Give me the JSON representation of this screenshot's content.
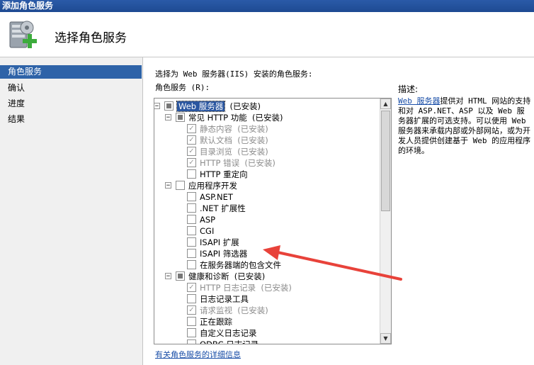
{
  "window": {
    "title": "添加角色服务"
  },
  "header": {
    "title": "选择角色服务"
  },
  "steps": [
    {
      "label": "角色服务",
      "active": true
    },
    {
      "label": "确认",
      "active": false
    },
    {
      "label": "进度",
      "active": false
    },
    {
      "label": "结果",
      "active": false
    }
  ],
  "main": {
    "instruction": "选择为 Web 服务器(IIS) 安装的角色服务:",
    "role_services_label": "角色服务 (R):",
    "description_label": "描述:",
    "description_link": "Web 服务器",
    "description_text": "提供对 HTML 网站的支持和对 ASP.NET、ASP 以及 Web 服务器扩展的可选支持。可以使用 Web 服务器来承载内部或外部网站，或为开发人员提供创建基于 Web 的应用程序的环境。",
    "more_info_link": "有关角色服务的详细信息"
  },
  "tree": [
    {
      "name": "Web 服务器",
      "status": "(已安装)",
      "level": 0,
      "expander": "−",
      "state": "partial",
      "selected": true
    },
    {
      "name": "常见 HTTP 功能",
      "status": "(已安装)",
      "level": 1,
      "expander": "−",
      "state": "partial"
    },
    {
      "name": "静态内容",
      "status": "(已安装)",
      "level": 2,
      "state": "checked-disabled"
    },
    {
      "name": "默认文档",
      "status": "(已安装)",
      "level": 2,
      "state": "checked-disabled"
    },
    {
      "name": "目录浏览",
      "status": "(已安装)",
      "level": 2,
      "state": "checked-disabled"
    },
    {
      "name": "HTTP 错误",
      "status": "(已安装)",
      "level": 2,
      "state": "checked-disabled"
    },
    {
      "name": "HTTP 重定向",
      "status": "",
      "level": 2,
      "state": "unchecked"
    },
    {
      "name": "应用程序开发",
      "status": "",
      "level": 1,
      "expander": "−",
      "state": "unchecked"
    },
    {
      "name": "ASP.NET",
      "status": "",
      "level": 2,
      "state": "unchecked"
    },
    {
      "name": ".NET 扩展性",
      "status": "",
      "level": 2,
      "state": "unchecked"
    },
    {
      "name": "ASP",
      "status": "",
      "level": 2,
      "state": "unchecked"
    },
    {
      "name": "CGI",
      "status": "",
      "level": 2,
      "state": "unchecked"
    },
    {
      "name": "ISAPI 扩展",
      "status": "",
      "level": 2,
      "state": "unchecked"
    },
    {
      "name": "ISAPI 筛选器",
      "status": "",
      "level": 2,
      "state": "unchecked"
    },
    {
      "name": "在服务器端的包含文件",
      "status": "",
      "level": 2,
      "state": "unchecked"
    },
    {
      "name": "健康和诊断",
      "status": "(已安装)",
      "level": 1,
      "expander": "−",
      "state": "partial"
    },
    {
      "name": "HTTP 日志记录",
      "status": "(已安装)",
      "level": 2,
      "state": "checked-disabled"
    },
    {
      "name": "日志记录工具",
      "status": "",
      "level": 2,
      "state": "unchecked"
    },
    {
      "name": "请求监视",
      "status": "(已安装)",
      "level": 2,
      "state": "checked-disabled"
    },
    {
      "name": "正在跟踪",
      "status": "",
      "level": 2,
      "state": "unchecked"
    },
    {
      "name": "自定义日志记录",
      "status": "",
      "level": 2,
      "state": "unchecked"
    },
    {
      "name": "ODBC 日志记录",
      "status": "",
      "level": 2,
      "state": "unchecked"
    }
  ],
  "icons": {
    "header_icon": "server-add-icon",
    "arrow": "annotation-arrow"
  },
  "colors": {
    "selection": "#2e63a8",
    "annotation_arrow": "#e8423a",
    "link": "#1b4fa8"
  }
}
